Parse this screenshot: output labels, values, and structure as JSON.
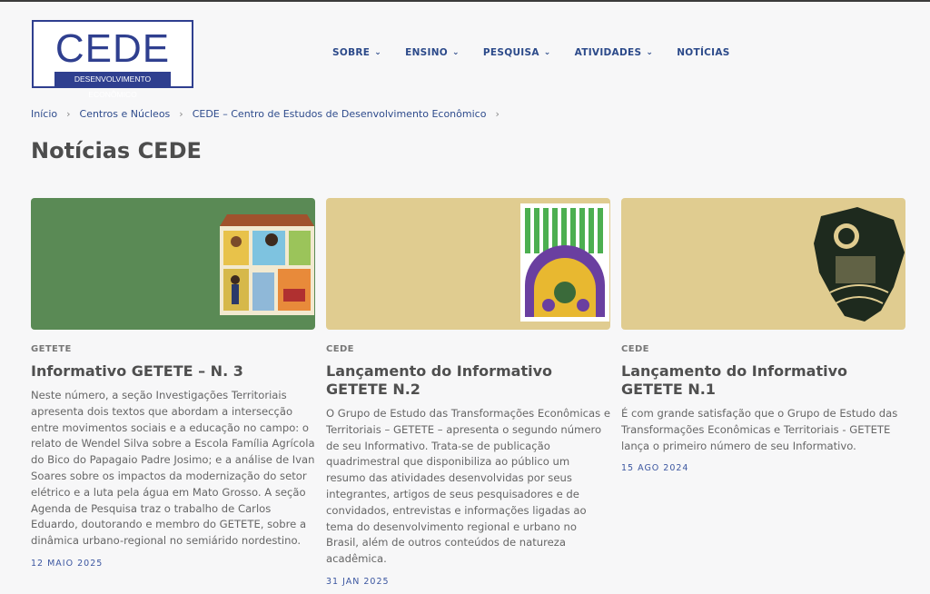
{
  "logo": {
    "main": "CEDE",
    "sub": "DESENVOLVIMENTO ECONÔMICO"
  },
  "nav": [
    {
      "label": "SOBRE",
      "has_dropdown": true
    },
    {
      "label": "ENSINO",
      "has_dropdown": true
    },
    {
      "label": "PESQUISA",
      "has_dropdown": true
    },
    {
      "label": "ATIVIDADES",
      "has_dropdown": true
    },
    {
      "label": "NOTÍCIAS",
      "has_dropdown": false
    }
  ],
  "breadcrumb": [
    "Início",
    "Centros e Núcleos",
    "CEDE – Centro de Estudos de Desenvolvimento Econômico"
  ],
  "page_title": "Notícias CEDE",
  "colors": {
    "accent": "#2f3f8f",
    "card1_bg": "#5a8a55",
    "card2_bg": "#e0cc90",
    "card3_bg": "#e0cc90"
  },
  "cards": [
    {
      "category": "GETETE",
      "title": "Informativo GETETE – N. 3",
      "excerpt": "Neste número, a seção Investigações Territoriais apresenta dois textos que abordam a intersecção entre movimentos sociais e a educação no campo: o relato de Wendel Silva sobre a Escola Família Agrícola do Bico do Papagaio Padre Josimo; e a análise de Ivan Soares sobre os impactos da modernização do setor elétrico e a luta pela água em Mato Grosso. A seção Agenda de Pesquisa traz o trabalho de Carlos Eduardo, doutorando e membro do GETETE, sobre a dinâmica urbano-regional no semiárido nordestino.",
      "date": "12 MAIO 2025"
    },
    {
      "category": "CEDE",
      "title": "Lançamento do Informativo GETETE N.2",
      "excerpt": "O Grupo de Estudo das Transformações Econômicas e Territoriais – GETETE – apresenta o segundo número de seu Informativo. Trata-se de publicação quadrimestral que disponibiliza ao público um resumo das atividades desenvolvidas por seus integrantes, artigos de seus pesquisadores e de convidados, entrevistas e informações ligadas ao tema do desenvolvimento regional e urbano no Brasil, além de outros conteúdos de natureza acadêmica.",
      "date": "31 JAN 2025"
    },
    {
      "category": "CEDE",
      "title": "Lançamento do Informativo GETETE N.1",
      "excerpt": "É com grande satisfação que o Grupo de Estudo das Transformações Econômicas e Territoriais - GETETE lança o primeiro número de seu Informativo.",
      "date": "15 AGO 2024"
    }
  ]
}
